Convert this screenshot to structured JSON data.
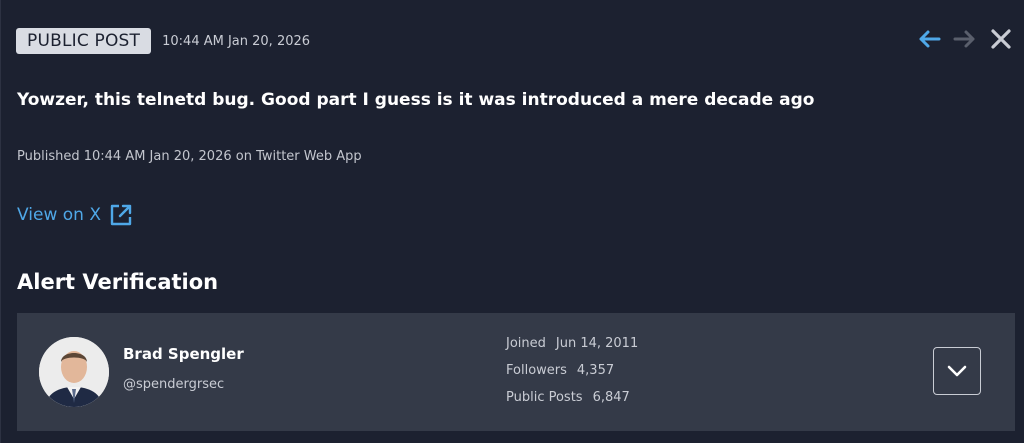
{
  "header": {
    "badge": "PUBLIC POST",
    "timestamp": "10:44 AM Jan 20, 2026"
  },
  "nav": {
    "back_icon": "arrow-left-icon",
    "forward_icon": "arrow-right-icon",
    "close_icon": "close-icon",
    "back_color": "#4fa8e8",
    "forward_color": "#5a5f6c",
    "close_color": "#c9ccd4"
  },
  "post": {
    "text": "Yowzer, this telnetd bug. Good part I guess is it was introduced a mere decade ago",
    "published": "Published 10:44 AM Jan 20, 2026 on Twitter Web App",
    "view_link": "View on X",
    "view_link_icon": "external-link-icon",
    "link_color": "#4fa8e8"
  },
  "verification": {
    "title": "Alert Verification",
    "user": {
      "name": "Brad Spengler",
      "handle": "@spendergrsec",
      "avatar_icon": "avatar"
    },
    "stats": [
      {
        "label": "Joined",
        "value": "Jun 14, 2011"
      },
      {
        "label": "Followers",
        "value": "4,357"
      },
      {
        "label": "Public Posts",
        "value": "6,847"
      }
    ],
    "expand_icon": "chevron-down-icon"
  }
}
